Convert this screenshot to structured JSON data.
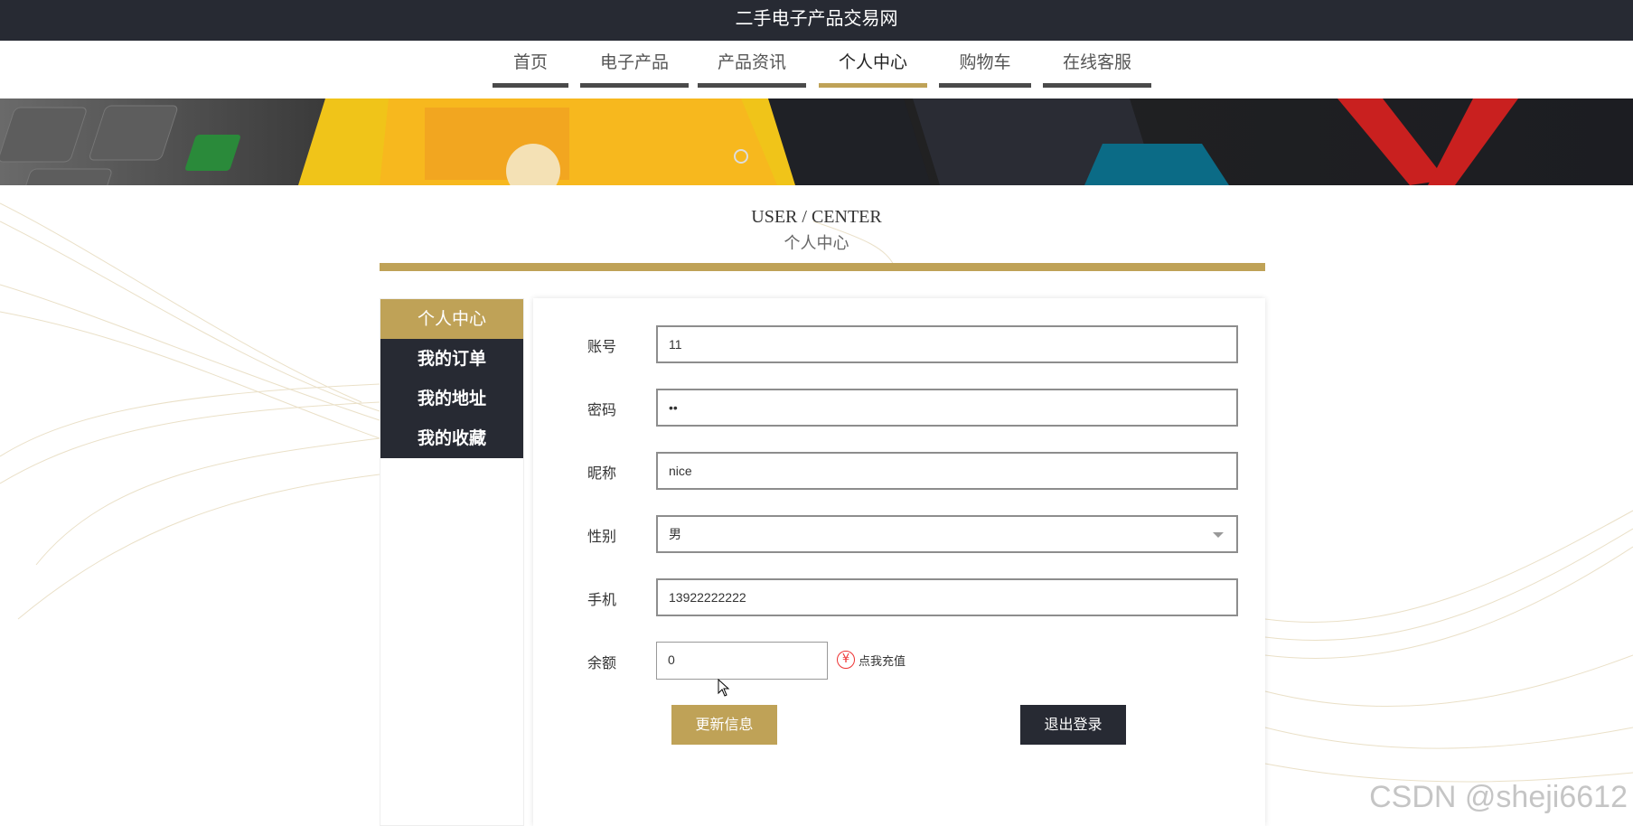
{
  "site_title": "二手电子产品交易网",
  "nav": [
    {
      "label": "首页",
      "active": false
    },
    {
      "label": "电子产品",
      "active": false
    },
    {
      "label": "产品资讯",
      "active": false
    },
    {
      "label": "个人中心",
      "active": true
    },
    {
      "label": "购物车",
      "active": false
    },
    {
      "label": "在线客服",
      "active": false
    }
  ],
  "section": {
    "title_en": "USER / CENTER",
    "title_cn": "个人中心"
  },
  "sidebar": [
    {
      "label": "个人中心",
      "active": true
    },
    {
      "label": "我的订单",
      "active": false
    },
    {
      "label": "我的地址",
      "active": false
    },
    {
      "label": "我的收藏",
      "active": false
    }
  ],
  "form": {
    "account": {
      "label": "账号",
      "value": "11"
    },
    "password": {
      "label": "密码",
      "value": "••"
    },
    "nickname": {
      "label": "昵称",
      "value": "nice"
    },
    "gender": {
      "label": "性别",
      "value": "男"
    },
    "phone": {
      "label": "手机",
      "value": "13922222222"
    },
    "balance": {
      "label": "余额",
      "value": "0",
      "recharge_label": "点我充值",
      "recharge_icon": "yen-icon"
    }
  },
  "buttons": {
    "update": "更新信息",
    "logout": "退出登录"
  },
  "watermark": "CSDN @sheji6612",
  "colors": {
    "dark": "#272a33",
    "gold": "#bfa257"
  }
}
